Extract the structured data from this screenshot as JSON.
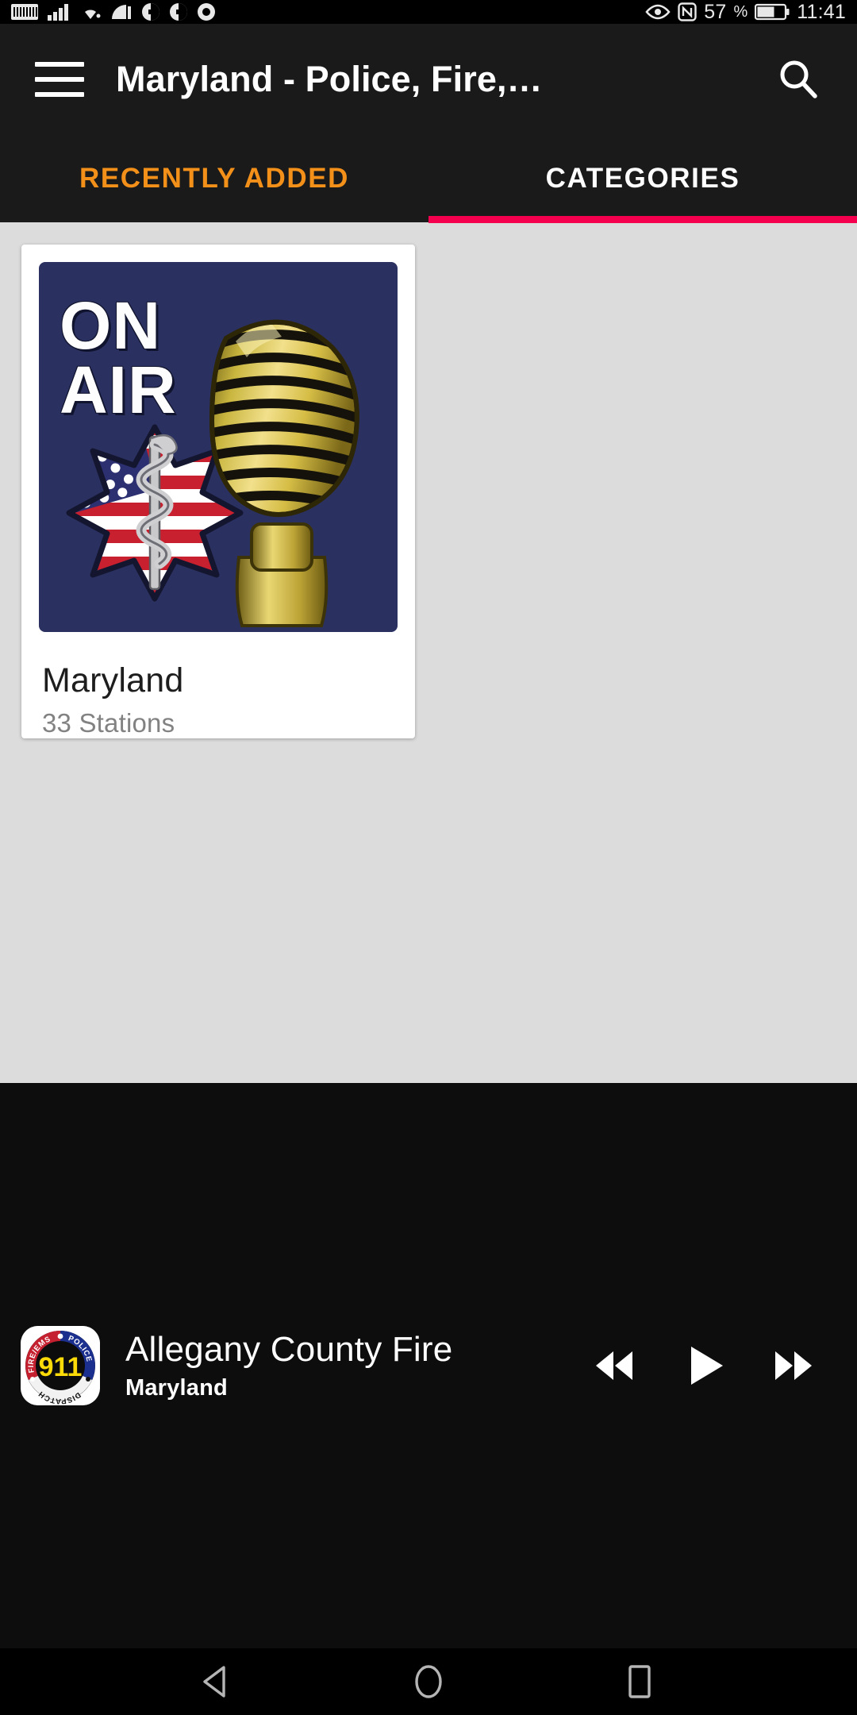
{
  "status_bar": {
    "battery_percent": "57",
    "percent_symbol": "%",
    "time": "11:41",
    "left_icons": [
      "wifi-label-icon",
      "signal-bars-icon",
      "wifi-icon",
      "cast-icon",
      "app-badge-icon-1",
      "app-badge-icon-2",
      "app-badge-icon-3"
    ],
    "right_icons": [
      "eye-icon",
      "nfc-icon",
      "battery-icon"
    ]
  },
  "appbar": {
    "menu_icon": "hamburger-menu-icon",
    "title": "Maryland - Police, Fire,…",
    "search_icon": "search-icon"
  },
  "tabs": {
    "items": [
      {
        "label": "RECENTLY ADDED",
        "active": false,
        "color": "#f39019"
      },
      {
        "label": "CATEGORIES",
        "active": true,
        "color": "#ffffff"
      }
    ],
    "indicator_color": "#f5004f"
  },
  "content": {
    "background_color": "#dcdcdc",
    "cards": [
      {
        "title": "Maryland",
        "subtitle": "33 Stations",
        "artwork": {
          "line1": "ON",
          "line2": "AIR",
          "background_color": "#2a3060",
          "elements": [
            "gold-microphone-icon",
            "star-of-life-flag-icon"
          ]
        }
      }
    ]
  },
  "player": {
    "artwork_name": "911-dispatch-badge-icon",
    "badge_text": {
      "center": "911",
      "left_arc": "FIRE/EMS",
      "right_arc": "POLICE",
      "bottom_arc": "DISPATCH"
    },
    "station_title": "Allegany County Fire",
    "station_subtitle": "Maryland",
    "controls": [
      {
        "name": "previous-button",
        "icon": "rewind-icon"
      },
      {
        "name": "play-button",
        "icon": "play-icon"
      },
      {
        "name": "next-button",
        "icon": "fast-forward-icon"
      }
    ]
  },
  "navbar": {
    "buttons": [
      {
        "name": "back-button",
        "icon": "back-triangle-icon"
      },
      {
        "name": "home-button",
        "icon": "home-circle-icon"
      },
      {
        "name": "recents-button",
        "icon": "recents-square-icon"
      }
    ]
  }
}
